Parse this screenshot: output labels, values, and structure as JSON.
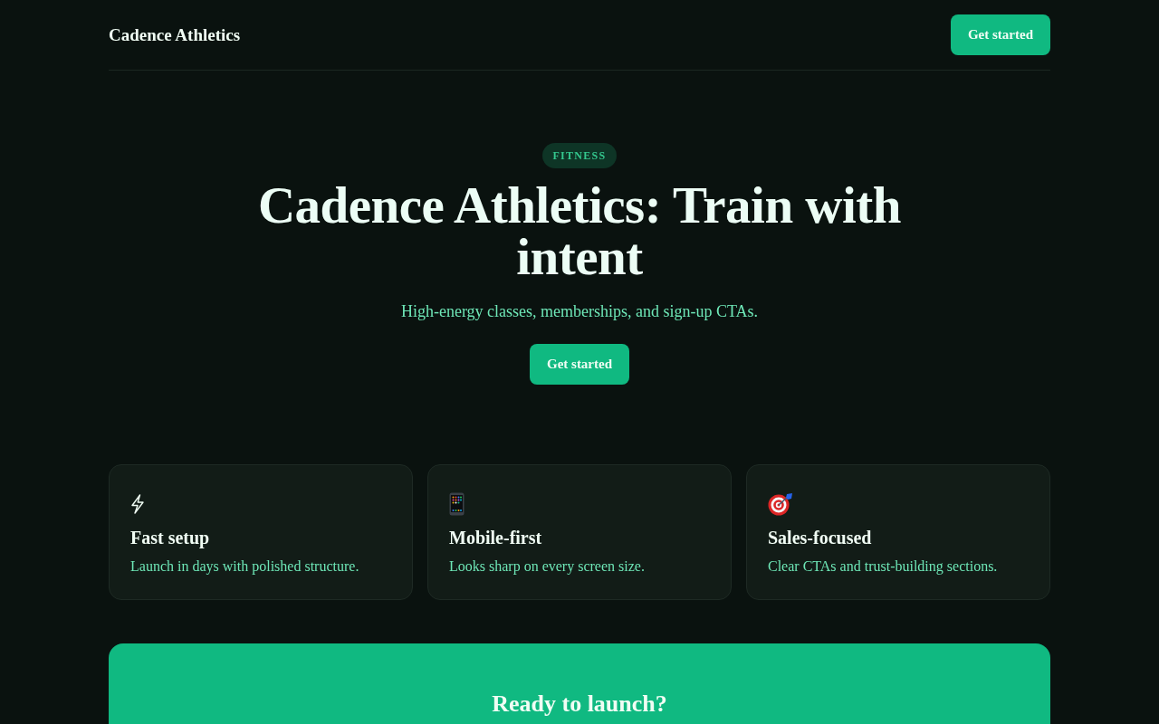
{
  "header": {
    "brand": "Cadence Athletics",
    "button": "Get started"
  },
  "hero": {
    "badge": "FITNESS",
    "title": "Cadence Athletics: Train with intent",
    "subtitle": "High-energy classes, memberships, and sign-up CTAs.",
    "button": "Get started"
  },
  "features": [
    {
      "kind": "bolt",
      "title": "Fast setup",
      "text": "Launch in days with polished structure."
    },
    {
      "kind": "phone",
      "title": "Mobile-first",
      "text": "Looks sharp on every screen size."
    },
    {
      "kind": "target",
      "title": "Sales-focused",
      "text": "Clear CTAs and trust-building sections."
    }
  ],
  "cta": {
    "title": "Ready to launch?"
  }
}
